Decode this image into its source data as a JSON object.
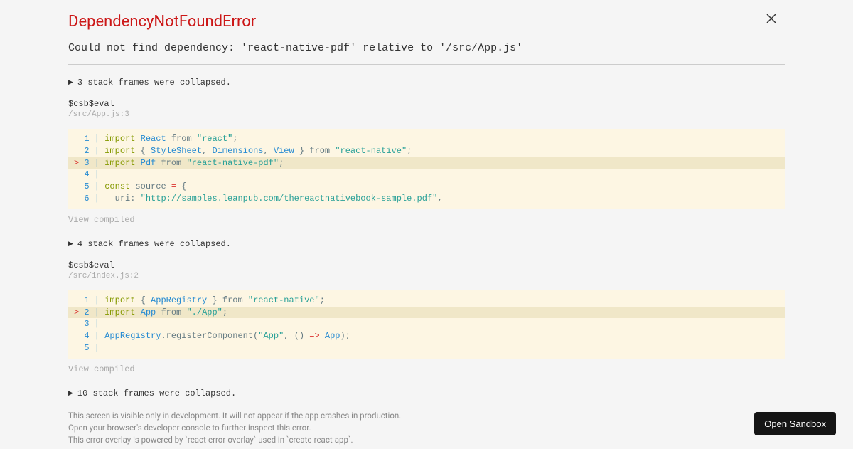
{
  "error": {
    "title": "DependencyNotFoundError",
    "message": "Could not find dependency: 'react-native-pdf' relative to '/src/App.js'"
  },
  "frames": [
    {
      "collapsed_text": "3 stack frames were collapsed.",
      "name": "$csb$eval",
      "location": "/src/App.js:3",
      "view_compiled": "View compiled"
    },
    {
      "collapsed_text": "4 stack frames were collapsed.",
      "name": "$csb$eval",
      "location": "/src/index.js:2",
      "view_compiled": "View compiled"
    },
    {
      "collapsed_text": "10 stack frames were collapsed."
    }
  ],
  "footer": {
    "line1": "This screen is visible only in development. It will not appear if the app crashes in production.",
    "line2": "Open your browser's developer console to further inspect this error.",
    "line3": "This error overlay is powered by `react-error-overlay` used in `create-react-app`."
  },
  "open_sandbox": "Open Sandbox"
}
